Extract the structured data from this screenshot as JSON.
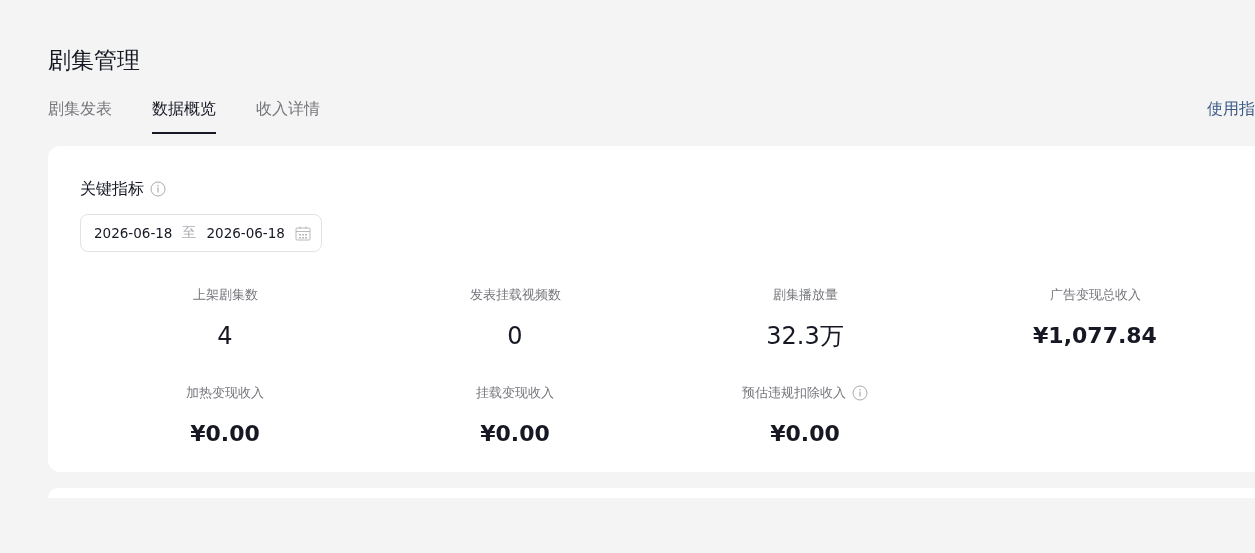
{
  "page_title": "剧集管理",
  "tabs": [
    {
      "label": "剧集发表",
      "selected": false
    },
    {
      "label": "数据概览",
      "selected": true
    },
    {
      "label": "收入详情",
      "selected": false
    }
  ],
  "guide_link": "使用指",
  "card": {
    "title": "关键指标",
    "date_range": {
      "start": "2026-06-18",
      "separator": "至",
      "end": "2026-06-18"
    },
    "metrics": [
      {
        "label": "上架剧集数",
        "value": "4",
        "kind": "count",
        "info": false
      },
      {
        "label": "发表挂载视频数",
        "value": "0",
        "kind": "count",
        "info": false
      },
      {
        "label": "剧集播放量",
        "value": "32.3万",
        "kind": "count",
        "info": false
      },
      {
        "label": "广告变现总收入",
        "value": "¥1,077.84",
        "kind": "amount",
        "info": false
      },
      {
        "label": "加热变现收入",
        "value": "¥0.00",
        "kind": "amount",
        "info": false
      },
      {
        "label": "挂载变现收入",
        "value": "¥0.00",
        "kind": "amount",
        "info": false
      },
      {
        "label": "预估违规扣除收入",
        "value": "¥0.00",
        "kind": "amount",
        "info": true
      }
    ]
  }
}
